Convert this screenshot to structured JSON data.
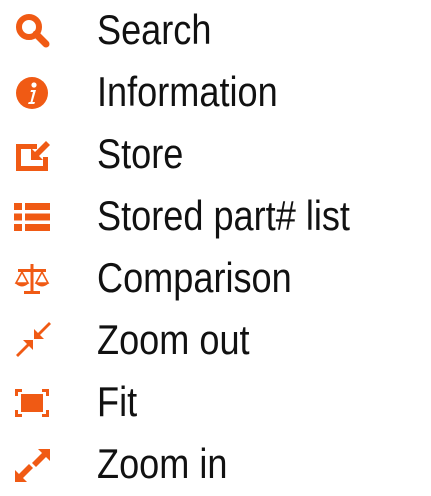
{
  "accent_color": "#f05a14",
  "items": [
    {
      "label": "Search",
      "icon": "search-icon"
    },
    {
      "label": "Information",
      "icon": "info-icon"
    },
    {
      "label": "Store",
      "icon": "store-icon"
    },
    {
      "label": "Stored part# list",
      "icon": "list-icon"
    },
    {
      "label": "Comparison",
      "icon": "scale-icon"
    },
    {
      "label": "Zoom out",
      "icon": "zoom-out-icon"
    },
    {
      "label": "Fit",
      "icon": "fit-icon"
    },
    {
      "label": "Zoom in",
      "icon": "zoom-in-icon"
    }
  ]
}
